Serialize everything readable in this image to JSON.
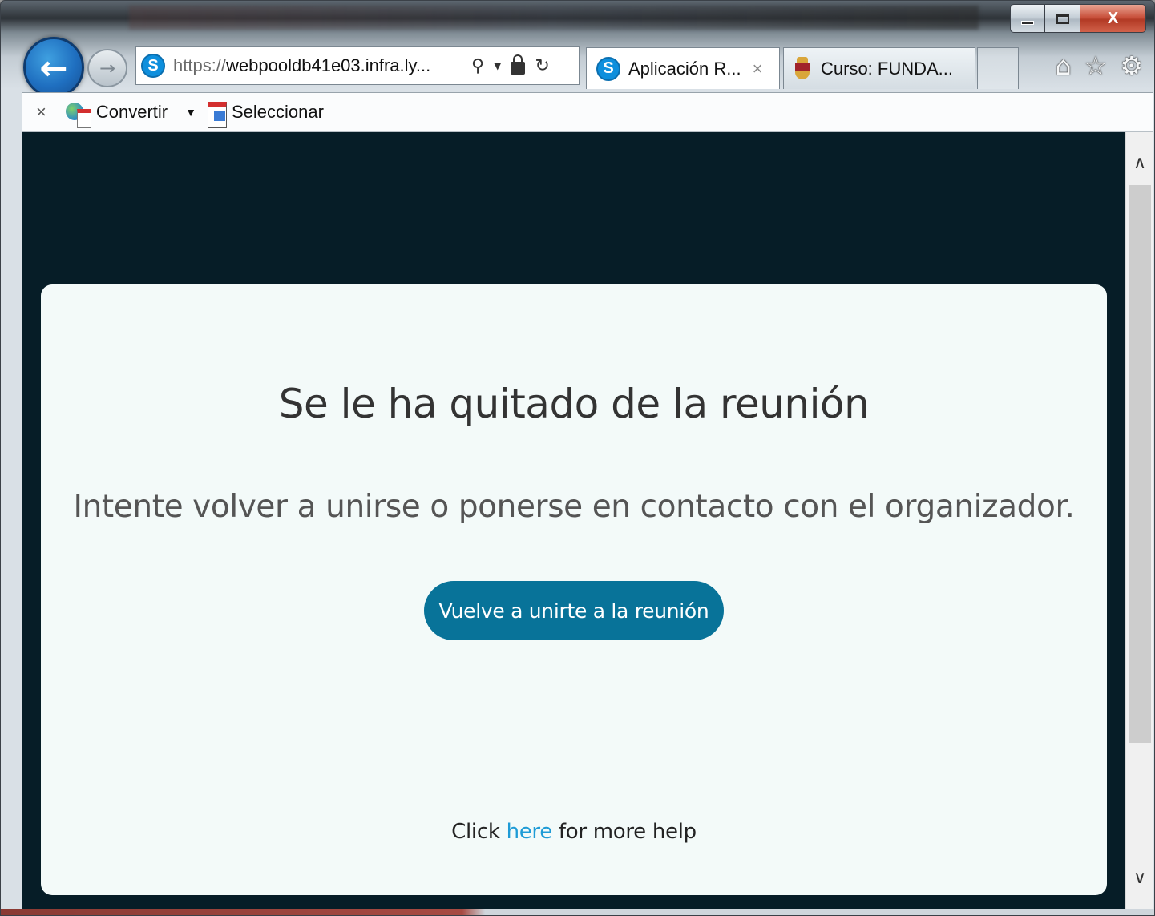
{
  "browser": {
    "address_bar": {
      "url_prefix": "https://",
      "url_domain": "webpooldb41e03.infra.ly...",
      "site_icon": "skype-icon",
      "search_icon": "search-icon",
      "lock_icon": "lock-icon",
      "refresh_icon": "refresh-icon"
    },
    "tabs": [
      {
        "label": "Aplicación R...",
        "icon": "skype-icon",
        "close": "×",
        "active": true
      },
      {
        "label": "Curso: FUNDA...",
        "icon": "crest-icon",
        "active": false
      }
    ],
    "toolbar_icons": [
      "home-icon",
      "favorites-star-icon",
      "settings-gear-icon"
    ],
    "caption": {
      "minimize": "minimize-icon",
      "maximize": "maximize-icon",
      "close": "X"
    },
    "command_bar": {
      "close": "×",
      "convert_label": "Convertir",
      "dropdown": "▼",
      "select_label": "Seleccionar"
    }
  },
  "page": {
    "title": "Se le ha quitado de la reunión",
    "subtitle": "Intente volver a unirse o ponerse en contacto con el organizador.",
    "rejoin_button": "Vuelve a unirte a la reunión",
    "help": {
      "prefix": "Click ",
      "link": "here",
      "suffix": " for more help"
    }
  },
  "colors": {
    "page_background": "#061d27",
    "card_background": "#f3faf9",
    "button_background": "#087399",
    "link": "#1e9bd6"
  }
}
